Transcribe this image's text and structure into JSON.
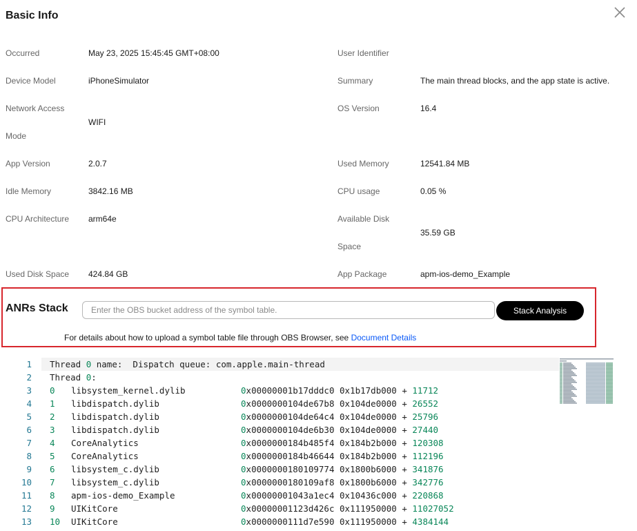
{
  "dialog": {
    "title": "Basic Info",
    "close_icon": "close-icon"
  },
  "info_left": [
    {
      "label": "Occurred",
      "value": "May 23, 2025 15:45:45 GMT+08:00"
    },
    {
      "label": "Device Model",
      "value": "iPhoneSimulator"
    },
    {
      "label_line1": "Network Access",
      "label_line2": "Mode",
      "value": "WIFI"
    },
    {
      "label": "App Version",
      "value": "2.0.7"
    },
    {
      "label": "Idle Memory",
      "value": "3842.16 MB"
    },
    {
      "label": "CPU Architecture",
      "value": "arm64e"
    },
    {
      "label": "Used Disk Space",
      "value": "424.84 GB"
    }
  ],
  "info_right": [
    {
      "label": "User Identifier",
      "value": ""
    },
    {
      "label": "Summary",
      "value": "The main thread blocks, and the app state is active."
    },
    {
      "label": "OS Version",
      "value": "16.4"
    },
    {
      "label": "Used Memory",
      "value": "12541.84 MB"
    },
    {
      "label": "CPU usage",
      "value": "0.05 %"
    },
    {
      "label_line1": "Available Disk",
      "label_line2": "Space",
      "value": "35.59 GB"
    },
    {
      "label": "App Package",
      "value": "apm-ios-demo_Example"
    }
  ],
  "anr": {
    "title": "ANRs Stack",
    "input_placeholder": "Enter the OBS bucket address of the symbol table.",
    "input_value": "",
    "button_label": "Stack Analysis",
    "hint_text": "For details about how to upload a symbol table file through OBS Browser, see ",
    "hint_link": "Document Details"
  },
  "stack": {
    "header": [
      {
        "num": "1",
        "prefix": "Thread ",
        "idx": "0",
        "suffix": " name:  Dispatch queue: com.apple.main-thread"
      },
      {
        "num": "2",
        "prefix": "Thread ",
        "idx": "0",
        "suffix": ":"
      }
    ],
    "frames": [
      {
        "num": "3",
        "idx": "0",
        "lib": "libsystem_kernel.dylib",
        "addr": "00000001b17dddc0",
        "base": "0x1b17db000",
        "offset": "11712"
      },
      {
        "num": "4",
        "idx": "1",
        "lib": "libdispatch.dylib",
        "addr": "0000000104de67b8",
        "base": "0x104de0000",
        "offset": "26552"
      },
      {
        "num": "5",
        "idx": "2",
        "lib": "libdispatch.dylib",
        "addr": "0000000104de64c4",
        "base": "0x104de0000",
        "offset": "25796"
      },
      {
        "num": "6",
        "idx": "3",
        "lib": "libdispatch.dylib",
        "addr": "0000000104de6b30",
        "base": "0x104de0000",
        "offset": "27440"
      },
      {
        "num": "7",
        "idx": "4",
        "lib": "CoreAnalytics",
        "addr": "0000000184b485f4",
        "base": "0x184b2b000",
        "offset": "120308"
      },
      {
        "num": "8",
        "idx": "5",
        "lib": "CoreAnalytics",
        "addr": "0000000184b46644",
        "base": "0x184b2b000",
        "offset": "112196"
      },
      {
        "num": "9",
        "idx": "6",
        "lib": "libsystem_c.dylib",
        "addr": "0000000180109774",
        "base": "0x1800b6000",
        "offset": "341876"
      },
      {
        "num": "10",
        "idx": "7",
        "lib": "libsystem_c.dylib",
        "addr": "0000000180109af8",
        "base": "0x1800b6000",
        "offset": "342776"
      },
      {
        "num": "11",
        "idx": "8",
        "lib": "apm-ios-demo_Example",
        "addr": "00000001043a1ec4",
        "base": "0x10436c000",
        "offset": "220868"
      },
      {
        "num": "12",
        "idx": "9",
        "lib": "UIKitCore",
        "addr": "00000001123d426c",
        "base": "0x111950000",
        "offset": "11027052"
      },
      {
        "num": "13",
        "idx": "10",
        "lib": "UIKitCore",
        "addr": "0000000111d7e590",
        "base": "0x111950000",
        "offset": "4384144"
      }
    ]
  },
  "colors": {
    "highlight_border": "#d7262c",
    "link": "#0a59f7",
    "number_green": "#098658",
    "line_number": "#237893"
  }
}
